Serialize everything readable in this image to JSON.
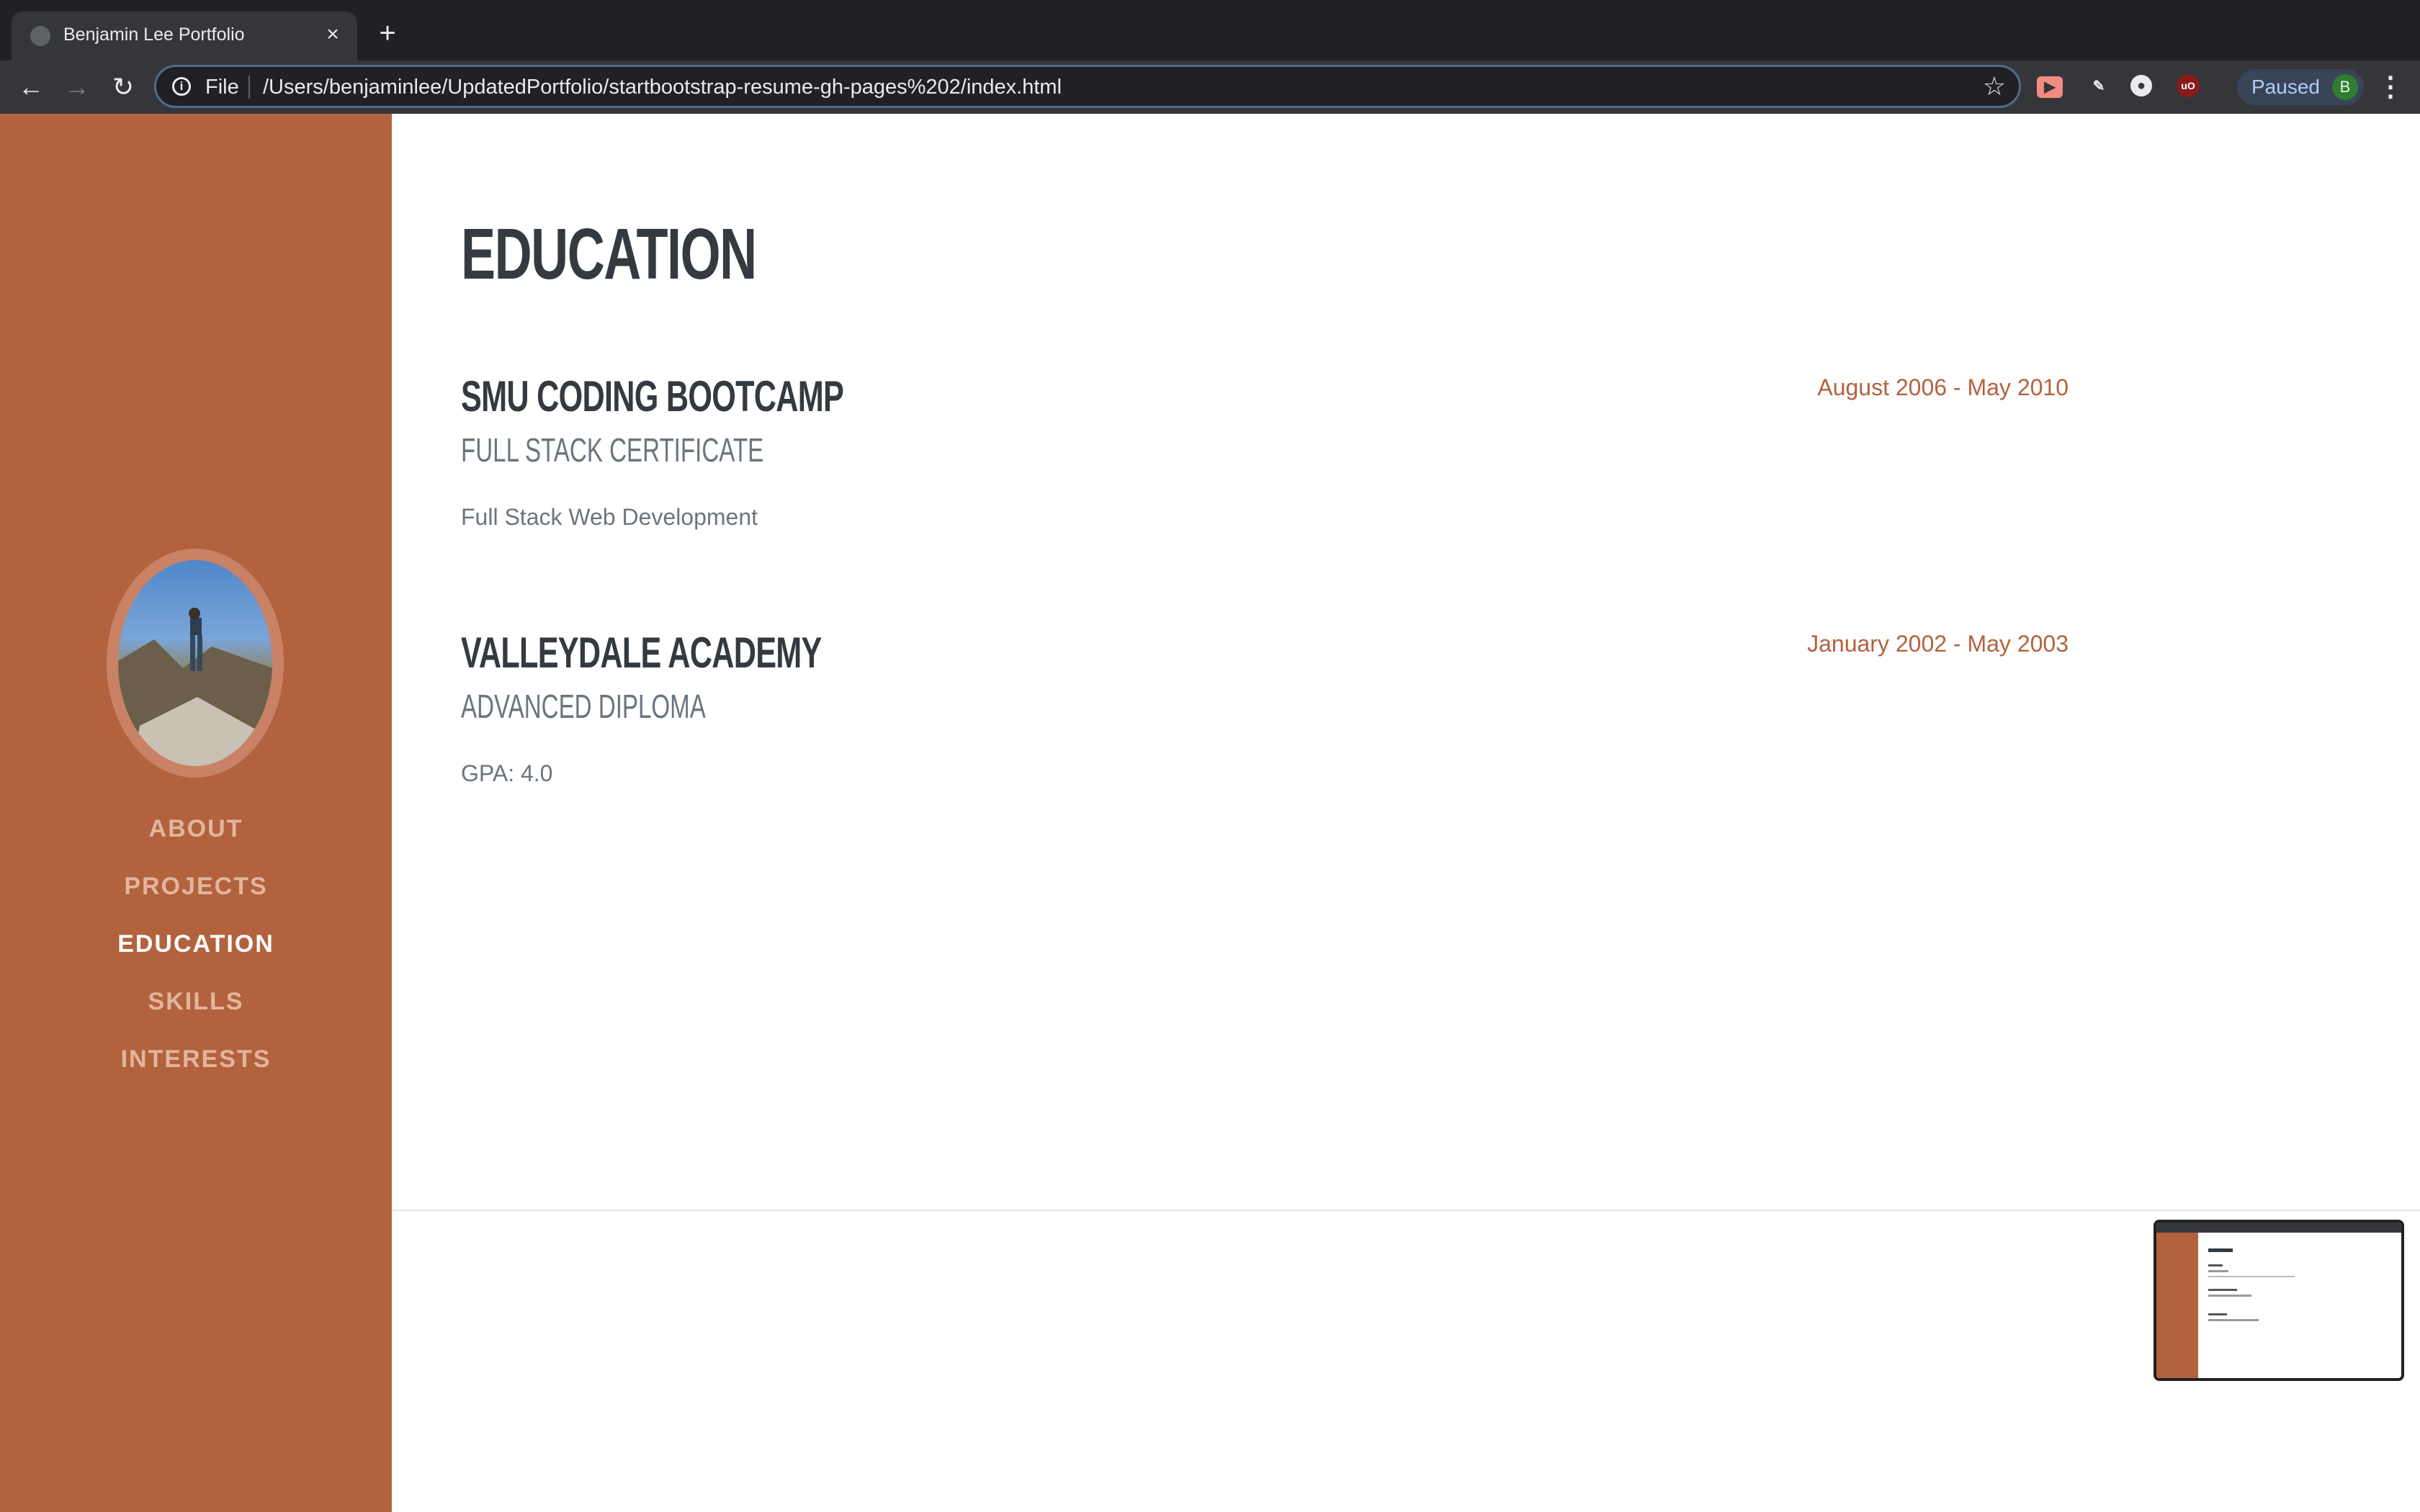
{
  "browser": {
    "tab_title": "Benjamin Lee Portfolio",
    "scheme_label": "File",
    "url": "/Users/benjaminlee/UpdatedPortfolio/startbootstrap-resume-gh-pages%202/index.html",
    "profile_status": "Paused",
    "profile_initial": "B"
  },
  "sidebar": {
    "nav": [
      {
        "label": "ABOUT",
        "active": false
      },
      {
        "label": "PROJECTS",
        "active": false
      },
      {
        "label": "EDUCATION",
        "active": true
      },
      {
        "label": "SKILLS",
        "active": false
      },
      {
        "label": "INTERESTS",
        "active": false
      }
    ]
  },
  "education": {
    "heading": "EDUCATION",
    "entries": [
      {
        "school": "SMU CODING BOOTCAMP",
        "degree": "FULL STACK CERTIFICATE",
        "detail": "Full Stack Web Development",
        "dates": "August 2006 - May 2010"
      },
      {
        "school": "VALLEYDALE ACADEMY",
        "degree": "ADVANCED DIPLOMA",
        "detail": "GPA: 4.0",
        "dates": "January 2002 - May 2003"
      }
    ]
  },
  "colors": {
    "sidebar": "#b3623e",
    "heading": "#343a40",
    "muted": "#6c757d",
    "accent": "#b3623e"
  }
}
